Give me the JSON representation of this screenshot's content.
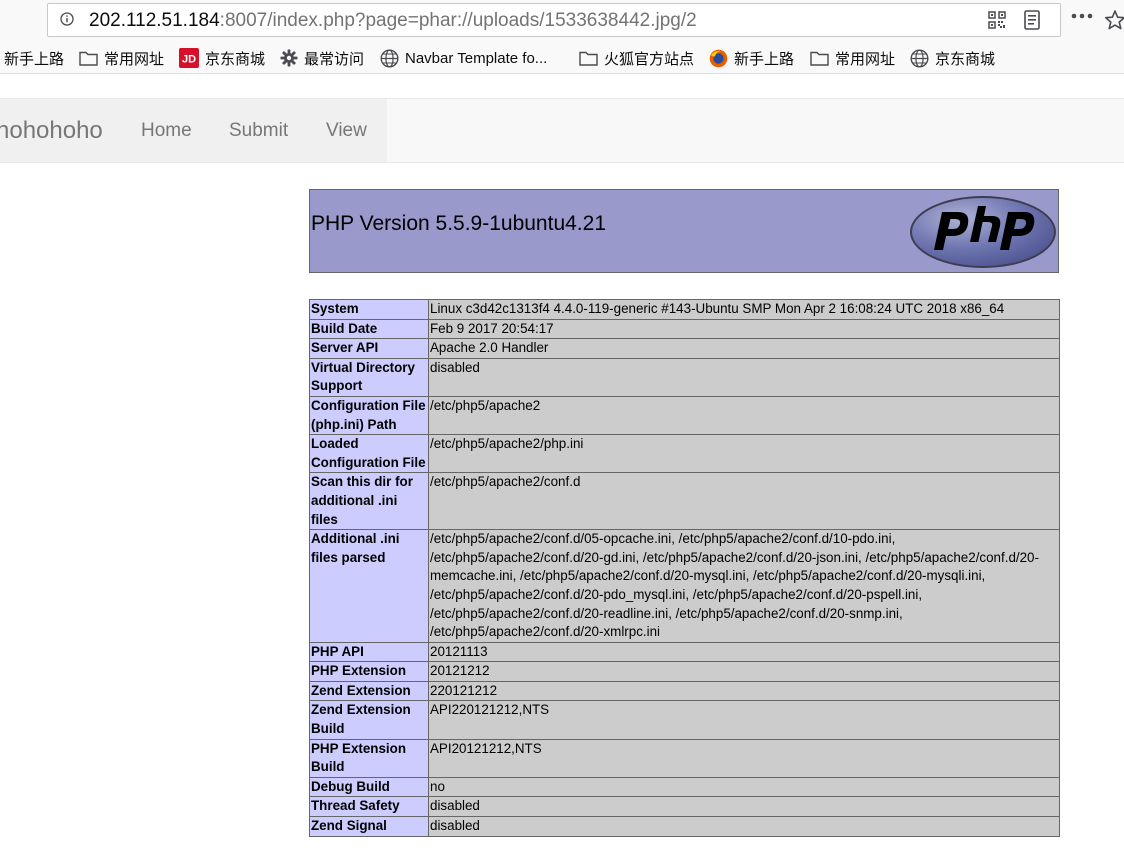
{
  "browser": {
    "url_host": "202.112.51.184",
    "url_rest": ":8007/index.php?page=phar://uploads/1533638442.jpg/2",
    "bookmarks": [
      {
        "label": "新手上路",
        "icon": "firefox-icon"
      },
      {
        "label": "常用网址",
        "icon": "folder-icon"
      },
      {
        "label": "京东商城",
        "icon": "jd-icon"
      },
      {
        "label": "最常访问",
        "icon": "gear-icon"
      },
      {
        "label": "Navbar Template fo...",
        "icon": "globe-icon"
      },
      {
        "label": "火狐官方站点",
        "icon": "folder-icon"
      },
      {
        "label": "新手上路",
        "icon": "firefox-icon"
      },
      {
        "label": "常用网址",
        "icon": "folder-icon"
      },
      {
        "label": "京东商城",
        "icon": "globe-icon"
      }
    ]
  },
  "navbar": {
    "brand": "hohohoho",
    "links": [
      "Home",
      "Submit",
      "View"
    ]
  },
  "phpinfo": {
    "title": "PHP Version 5.5.9-1ubuntu4.21",
    "rows": [
      {
        "k": "System",
        "v": "Linux c3d42c1313f4 4.4.0-119-generic #143-Ubuntu SMP Mon Apr 2 16:08:24 UTC 2018 x86_64"
      },
      {
        "k": "Build Date",
        "v": "Feb 9 2017 20:54:17"
      },
      {
        "k": "Server API",
        "v": "Apache 2.0 Handler"
      },
      {
        "k": "Virtual Directory Support",
        "v": "disabled"
      },
      {
        "k": "Configuration File (php.ini) Path",
        "v": "/etc/php5/apache2"
      },
      {
        "k": "Loaded Configuration File",
        "v": "/etc/php5/apache2/php.ini"
      },
      {
        "k": "Scan this dir for additional .ini files",
        "v": "/etc/php5/apache2/conf.d"
      },
      {
        "k": "Additional .ini files parsed",
        "v": "/etc/php5/apache2/conf.d/05-opcache.ini, /etc/php5/apache2/conf.d/10-pdo.ini, /etc/php5/apache2/conf.d/20-gd.ini, /etc/php5/apache2/conf.d/20-json.ini, /etc/php5/apache2/conf.d/20-memcache.ini, /etc/php5/apache2/conf.d/20-mysql.ini, /etc/php5/apache2/conf.d/20-mysqli.ini, /etc/php5/apache2/conf.d/20-pdo_mysql.ini, /etc/php5/apache2/conf.d/20-pspell.ini, /etc/php5/apache2/conf.d/20-readline.ini, /etc/php5/apache2/conf.d/20-snmp.ini, /etc/php5/apache2/conf.d/20-xmlrpc.ini"
      },
      {
        "k": "PHP API",
        "v": "20121113"
      },
      {
        "k": "PHP Extension",
        "v": "20121212"
      },
      {
        "k": "Zend Extension",
        "v": "220121212"
      },
      {
        "k": "Zend Extension Build",
        "v": "API220121212,NTS"
      },
      {
        "k": "PHP Extension Build",
        "v": "API20121212,NTS"
      },
      {
        "k": "Debug Build",
        "v": "no"
      },
      {
        "k": "Thread Safety",
        "v": "disabled"
      },
      {
        "k": "Zend Signal",
        "v": "disabled"
      }
    ]
  }
}
